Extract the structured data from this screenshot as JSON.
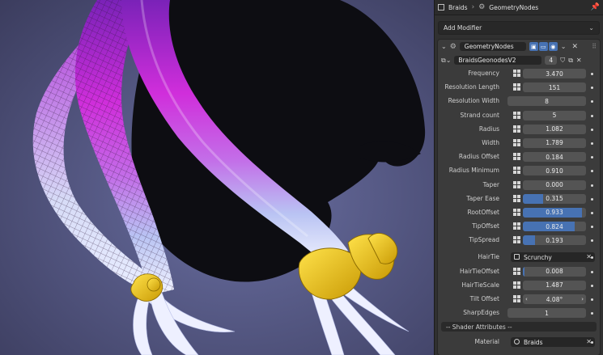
{
  "header": {
    "object_name": "Braids",
    "modifier_tab": "GeometryNodes"
  },
  "add_modifier": {
    "label": "Add Modifier"
  },
  "modifier": {
    "name": "GeometryNodes",
    "node_group": "BraidsGeonodesV2",
    "users": "4",
    "toggle_icons": [
      "edit-mode-icon",
      "viewport-icon",
      "render-icon"
    ]
  },
  "properties": [
    {
      "label": "Frequency",
      "value": "3.470",
      "slider": false
    },
    {
      "label": "Resolution Length",
      "value": "151",
      "slider": false
    },
    {
      "label": "Resolution Width",
      "value": "8",
      "slider": false,
      "wide": true
    },
    {
      "label": "Strand count",
      "value": "5",
      "slider": false
    },
    {
      "label": "Radius",
      "value": "1.082",
      "slider": false
    },
    {
      "label": "Width",
      "value": "1.789",
      "slider": false
    },
    {
      "label": "Radius Offset",
      "value": "0.184",
      "slider": false
    },
    {
      "label": "Radius Minimum",
      "value": "0.910",
      "slider": false
    },
    {
      "label": "Taper",
      "value": "0.000",
      "slider": false
    },
    {
      "label": "Taper Ease",
      "value": "0.315",
      "slider": true,
      "fraction": 0.315
    },
    {
      "label": "RootOffset",
      "value": "0.933",
      "slider": true,
      "fraction": 0.933
    },
    {
      "label": "TipOffset",
      "value": "0.824",
      "slider": true,
      "fraction": 0.824
    },
    {
      "label": "TipSpread",
      "value": "0.193",
      "slider": true,
      "fraction": 0.193
    }
  ],
  "hair_tie": {
    "label": "HairTie",
    "value": "Scrunchy"
  },
  "properties2": [
    {
      "label": "HairTieOffset",
      "value": "0.008",
      "slider": true,
      "fraction": 0.03
    },
    {
      "label": "HairTieScale",
      "value": "1.487",
      "slider": false
    }
  ],
  "tilt": {
    "label": "Tilt Offset",
    "value": "4.08°"
  },
  "sharp_edges": {
    "label": "SharpEdges",
    "value": "1"
  },
  "shader_attributes": {
    "label": "-- Shader Attributes --"
  },
  "material": {
    "label": "Material",
    "value": "Braids"
  },
  "colors": {
    "accent": "#4772b3",
    "panel": "#303030",
    "braid_pink": "#c22ad8",
    "braid_light": "#e6e8ff",
    "hair_tie": "#f0c810"
  }
}
